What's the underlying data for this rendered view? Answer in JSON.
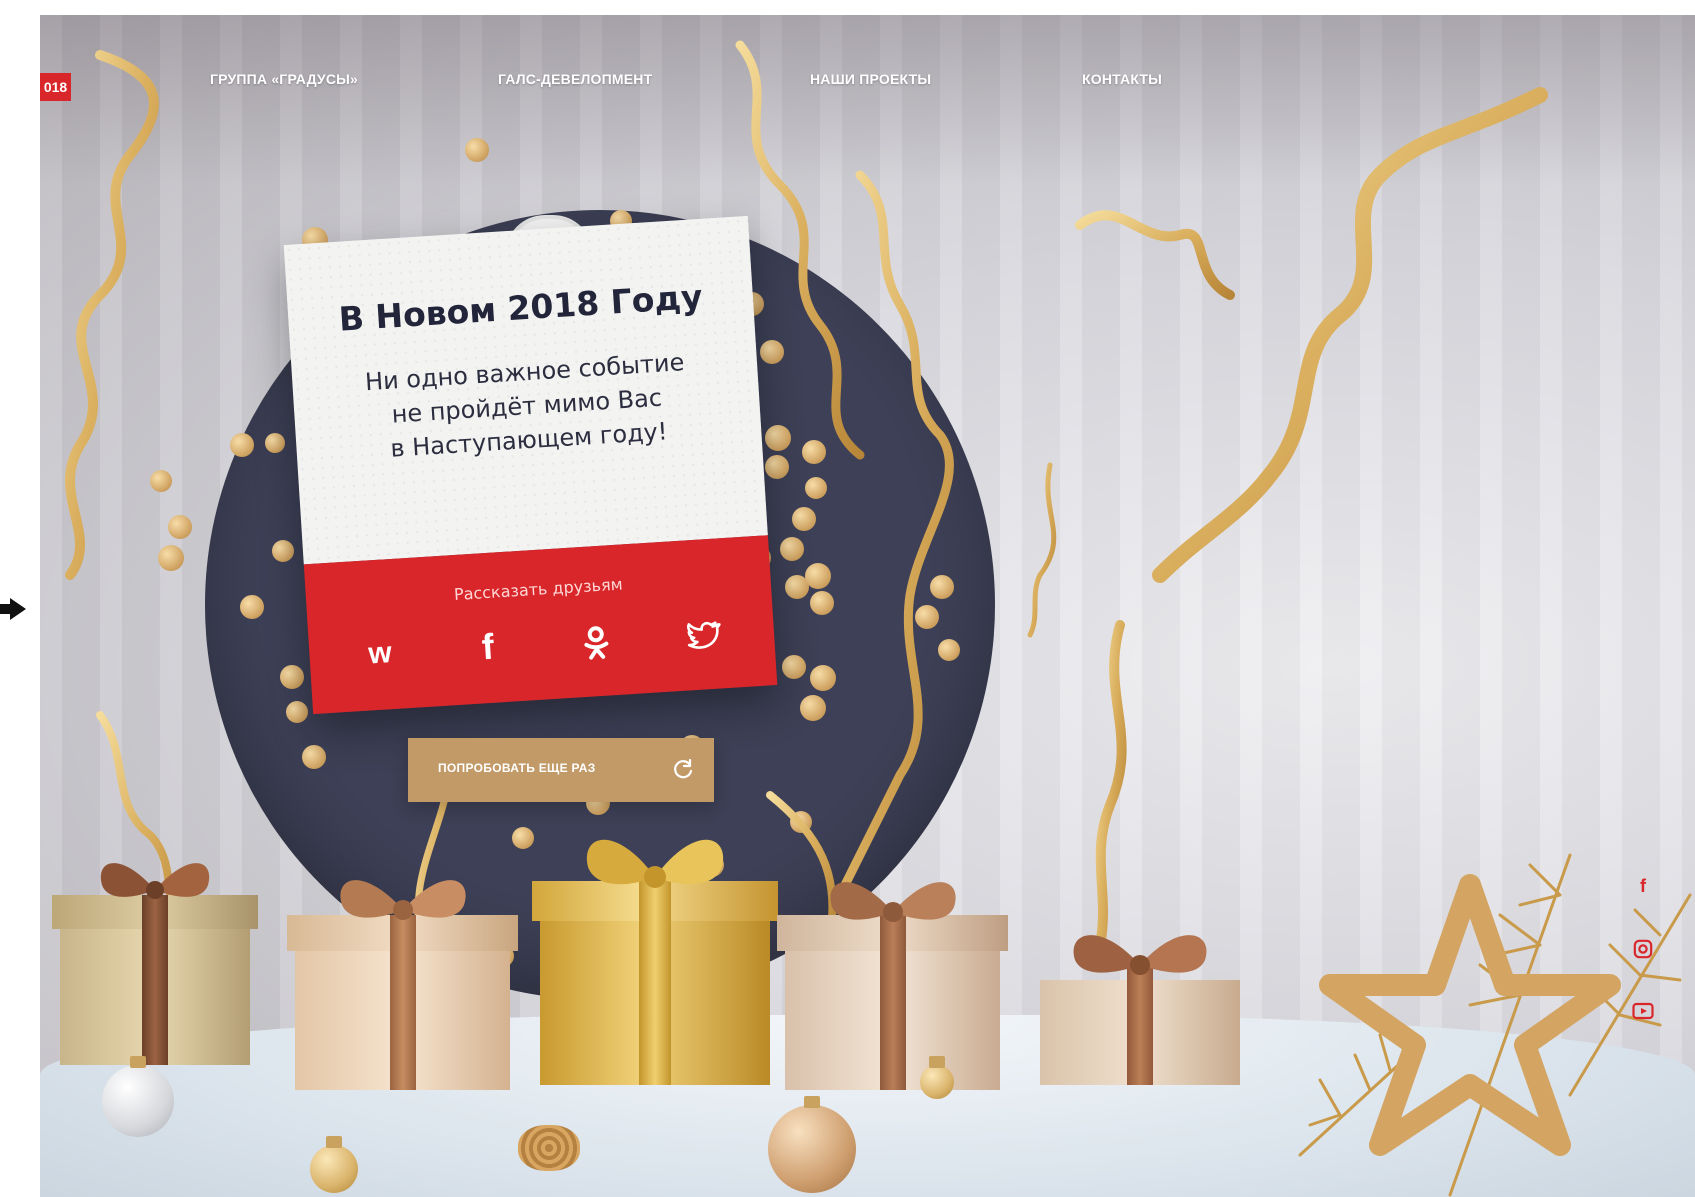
{
  "nav": {
    "logo_badge": "018",
    "links": [
      {
        "label": "ГРУППА «ГРАДУСЫ»"
      },
      {
        "label": "ГАЛС-ДЕВЕЛОПМЕНТ"
      },
      {
        "label": "НАШИ ПРОЕКТЫ"
      },
      {
        "label": "КОНТАКТЫ"
      }
    ]
  },
  "card": {
    "title": "В Новом 2018 Году",
    "lines": [
      "Ни одно важное событие",
      "не пройдёт мимо Вас",
      "в Наступающем году!"
    ],
    "share_label": "Рассказать друзьям",
    "socials": {
      "vk": "vk-icon",
      "facebook": "facebook-icon",
      "odnoklassniki": "odnoklassniki-icon",
      "twitter": "twitter-icon"
    }
  },
  "retry_button": {
    "label": "ПОПРОБОВАТЬ ЕЩЕ РАЗ",
    "icon": "refresh-icon"
  },
  "colors": {
    "accent_red": "#d8262a",
    "circle_navy": "#3d4056",
    "gold": "#c29a68"
  },
  "side_icons": [
    "facebook-icon",
    "instagram-icon",
    "youtube-icon"
  ]
}
